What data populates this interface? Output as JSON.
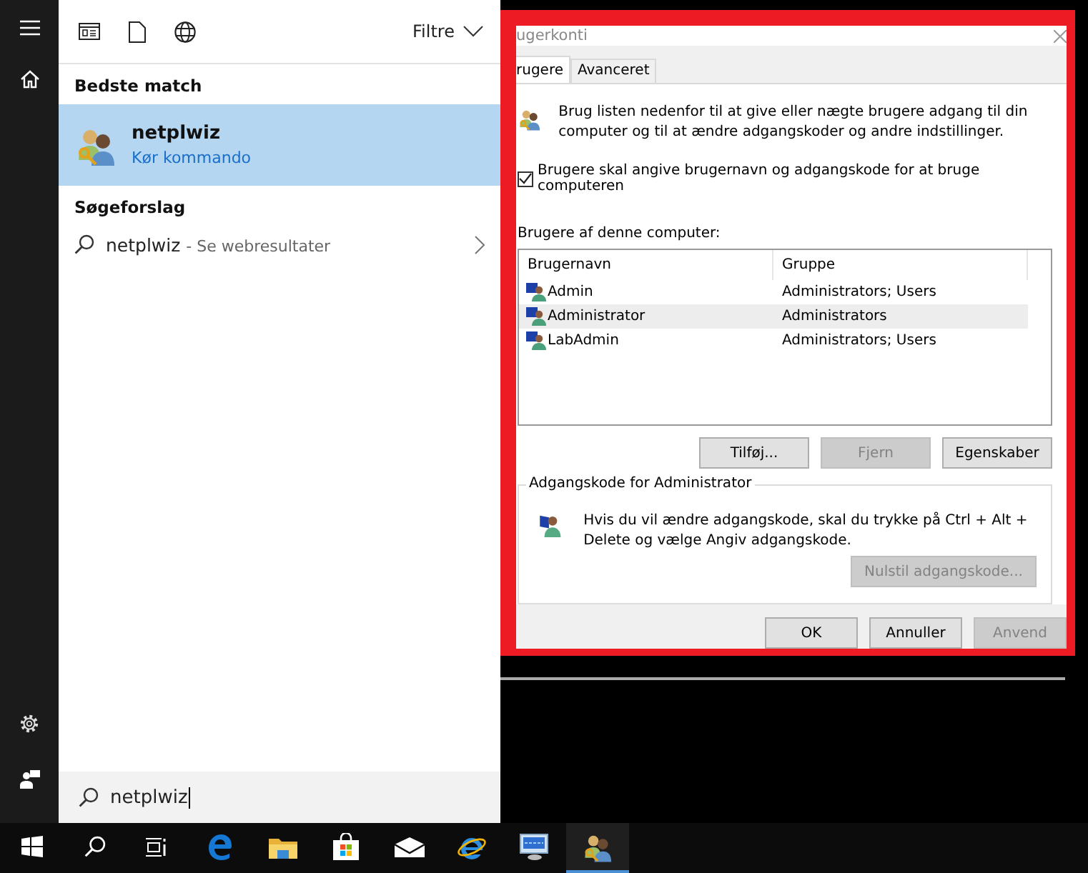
{
  "start_menu": {
    "filter_label": "Filtre",
    "sections": [
      {
        "heading": "Bedste match",
        "items": [
          {
            "kind": "app",
            "title": "netplwiz",
            "subtitle": "Kør kommando",
            "selected": true
          }
        ]
      },
      {
        "heading": "Søgeforslag",
        "items": [
          {
            "kind": "web",
            "title": "netplwiz",
            "suffix": "- Se webresultater",
            "selected": false
          }
        ]
      }
    ],
    "search": {
      "value": "netplwiz"
    }
  },
  "dialog": {
    "title": "ugerkonti",
    "tabs": [
      {
        "label": "rugere",
        "selected": true
      },
      {
        "label": "Avanceret",
        "selected": false
      }
    ],
    "intro": "Brug listen nedenfor til at give eller nægte brugere adgang til din computer og til at ændre adgangskoder og andre indstillinger.",
    "require_login": {
      "label": "Brugere skal angive brugernavn og adgangskode for at bruge computeren",
      "checked": true
    },
    "users_label": "Brugere af denne computer:",
    "columns": [
      "Brugernavn",
      "Gruppe"
    ],
    "rows": [
      {
        "name": "Admin",
        "group": "Administrators; Users",
        "selected": false
      },
      {
        "name": "Administrator",
        "group": "Administrators",
        "selected": true
      },
      {
        "name": "LabAdmin",
        "group": "Administrators; Users",
        "selected": false
      }
    ],
    "list_buttons": [
      {
        "label": "Tilføj...",
        "disabled": false
      },
      {
        "label": "Fjern",
        "disabled": true
      },
      {
        "label": "Egenskaber",
        "disabled": false
      }
    ],
    "password_group": {
      "legend": "Adgangskode for Administrator",
      "text": "Hvis du vil ændre adgangskode, skal du trykke på Ctrl + Alt + Delete og vælge Angiv adgangskode.",
      "button": {
        "label": "Nulstil adgangskode...",
        "disabled": true
      }
    },
    "buttons": [
      {
        "label": "OK",
        "disabled": false
      },
      {
        "label": "Annuller",
        "disabled": false
      },
      {
        "label": "Anvend",
        "disabled": true
      }
    ]
  },
  "taskbar": {
    "items": [
      {
        "kind": "start",
        "active": false
      },
      {
        "kind": "search",
        "active": false
      },
      {
        "kind": "taskview",
        "active": false
      },
      {
        "kind": "edge",
        "active": false
      },
      {
        "kind": "explorer",
        "active": false
      },
      {
        "kind": "store",
        "active": false
      },
      {
        "kind": "mail",
        "active": false
      },
      {
        "kind": "ie",
        "active": false
      },
      {
        "kind": "network",
        "active": false
      },
      {
        "kind": "users",
        "active": true
      }
    ]
  }
}
